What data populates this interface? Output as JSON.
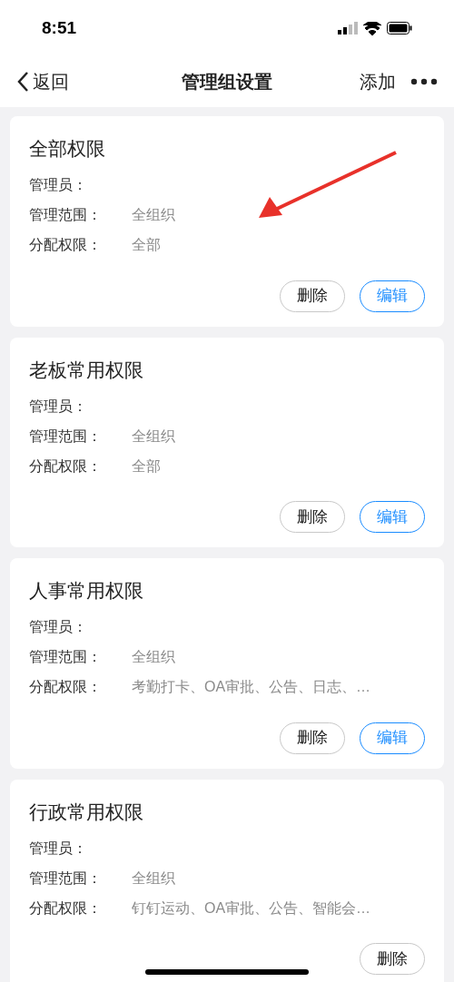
{
  "status_bar": {
    "time": "8:51"
  },
  "nav": {
    "back": "返回",
    "title": "管理组设置",
    "add": "添加"
  },
  "cards": [
    {
      "title": "全部权限",
      "rows": [
        {
          "label": "管理员："
        },
        {
          "label": "管理范围：",
          "value": "全组织"
        },
        {
          "label": "分配权限：",
          "value": "全部"
        }
      ],
      "buttons": [
        {
          "label": "删除",
          "kind": "delete"
        },
        {
          "label": "编辑",
          "kind": "edit"
        }
      ]
    },
    {
      "title": "老板常用权限",
      "rows": [
        {
          "label": "管理员："
        },
        {
          "label": "管理范围：",
          "value": "全组织"
        },
        {
          "label": "分配权限：",
          "value": "全部"
        }
      ],
      "buttons": [
        {
          "label": "删除",
          "kind": "delete"
        },
        {
          "label": "编辑",
          "kind": "edit"
        }
      ]
    },
    {
      "title": "人事常用权限",
      "rows": [
        {
          "label": "管理员："
        },
        {
          "label": "管理范围：",
          "value": "全组织"
        },
        {
          "label": "分配权限：",
          "value": "考勤打卡、OA审批、公告、日志、…"
        }
      ],
      "buttons": [
        {
          "label": "删除",
          "kind": "delete"
        },
        {
          "label": "编辑",
          "kind": "edit"
        }
      ]
    },
    {
      "title": "行政常用权限",
      "rows": [
        {
          "label": "管理员："
        },
        {
          "label": "管理范围：",
          "value": "全组织"
        },
        {
          "label": "分配权限：",
          "value": "钉钉运动、OA审批、公告、智能会…"
        }
      ],
      "buttons": [
        {
          "label": "删除",
          "kind": "delete"
        }
      ]
    }
  ]
}
